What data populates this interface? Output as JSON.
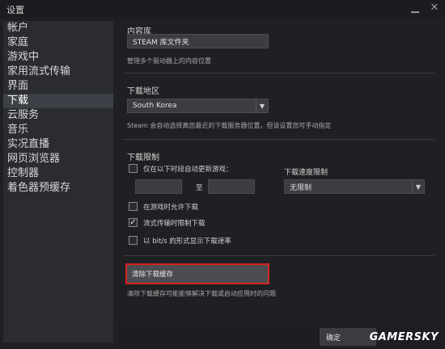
{
  "window": {
    "title": "设置"
  },
  "sidebar": {
    "items": [
      {
        "label": "帐户"
      },
      {
        "label": "家庭"
      },
      {
        "label": "游戏中"
      },
      {
        "label": "家用流式传输"
      },
      {
        "label": "界面"
      },
      {
        "label": "下载",
        "active": true
      },
      {
        "label": "云服务"
      },
      {
        "label": "音乐"
      },
      {
        "label": "实况直播"
      },
      {
        "label": "网页浏览器"
      },
      {
        "label": "控制器"
      },
      {
        "label": "着色器预缓存"
      }
    ]
  },
  "library": {
    "title": "内容库",
    "button_label": "STEAM 库文件夹",
    "description": "管理多个驱动器上的内容位置"
  },
  "region": {
    "title": "下载地区",
    "selected": "South Korea",
    "description": "Steam 会自动选择离您最近的下载服务器位置。但该设置您可手动指定"
  },
  "limits": {
    "title": "下载限制",
    "auto_update_label": "仅在以下时段自动更新游戏：",
    "to_label": "至",
    "speed_label": "下载速度限制",
    "speed_selected": "无限制",
    "allow_ingame_label": "在游戏时允许下载",
    "throttle_streaming_label": "流式传输时限制下载",
    "bits_label": "以 bit/s 的形式显示下载速率"
  },
  "checkboxes": {
    "auto_update": false,
    "allow_ingame": false,
    "throttle_streaming": true,
    "bits": false
  },
  "cache": {
    "button_label": "清除下载缓存",
    "description": "清除下载缓存可能能够解决下载或启动应用时的问题"
  },
  "footer": {
    "ok_label": "确定"
  },
  "watermark": "GAMERSKY",
  "glyphs": {
    "minimize": "▁",
    "close": "✕",
    "check": "✓",
    "dropdown": "▼"
  }
}
